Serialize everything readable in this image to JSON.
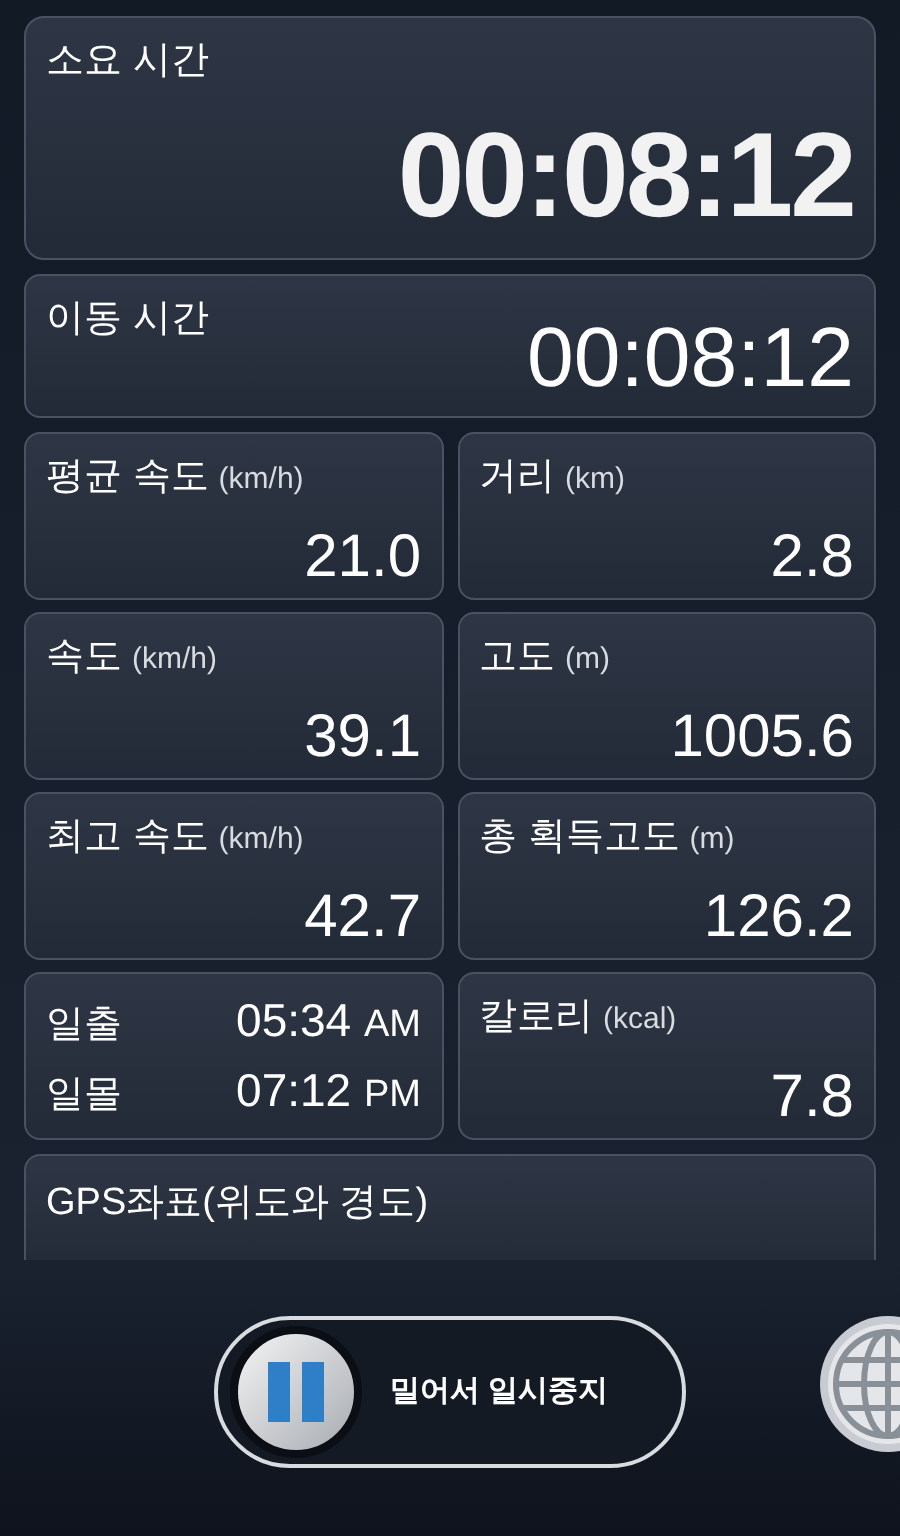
{
  "elapsed_time": {
    "label": "소요 시간",
    "value": "00:08:12"
  },
  "moving_time": {
    "label": "이동 시간",
    "value": "00:08:12"
  },
  "stats": [
    {
      "label": "평균 속도",
      "unit": "(km/h)",
      "value": "21.0"
    },
    {
      "label": "거리",
      "unit": "(km)",
      "value": "2.8"
    },
    {
      "label": "속도",
      "unit": "(km/h)",
      "value": "39.1"
    },
    {
      "label": "고도",
      "unit": "(m)",
      "value": "1005.6"
    },
    {
      "label": "최고 속도",
      "unit": "(km/h)",
      "value": "42.7"
    },
    {
      "label": "총 획득고도",
      "unit": "(m)",
      "value": "126.2"
    }
  ],
  "sun": [
    {
      "label": "일출",
      "time": "05:34",
      "period": "AM"
    },
    {
      "label": "일몰",
      "time": "07:12",
      "period": "PM"
    }
  ],
  "calories": {
    "label": "칼로리",
    "unit": "(kcal)",
    "value": "7.8"
  },
  "gps": {
    "label": "GPS좌표(위도와 경도)"
  },
  "pause_slider": {
    "label": "밀어서 일시중지",
    "level": 0
  }
}
